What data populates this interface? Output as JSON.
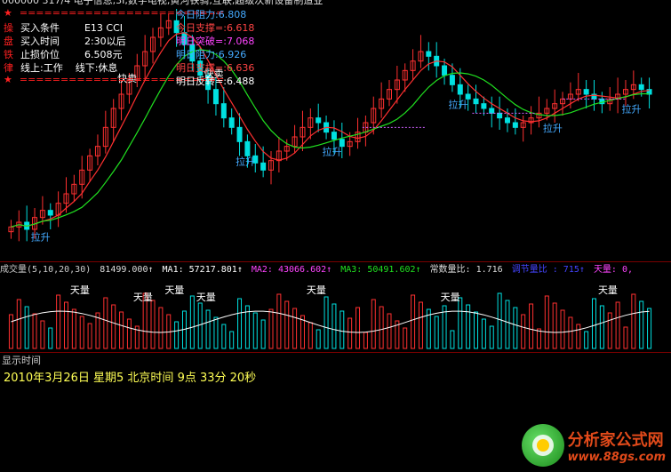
{
  "header": {
    "top_partial": "000000 317/4 电子信息,3I,数字电视,黄河铁骑,互联,超级次新设备制造业",
    "rows": [
      {
        "icon": "★",
        "label": "=========================",
        "color": "#ff2020"
      },
      {
        "icon": "操",
        "label": "买入条件        E13 CCI",
        "color": "#ffffff"
      },
      {
        "icon": "盘",
        "label": "买入时间        2:30以后",
        "color": "#ffffff"
      },
      {
        "icon": "铁",
        "label": "止损价位        6.508元",
        "color": "#ffffff"
      },
      {
        "icon": "律",
        "label": "线上:工作    线下:休息",
        "color": "#ffffff"
      },
      {
        "icon": "★",
        "label": "=========================",
        "color": "#ff2020"
      }
    ]
  },
  "levels": [
    {
      "label": "今日阻力:",
      "value": "6.808",
      "color": "#44aaff"
    },
    {
      "label": "今日支撑=:",
      "value": "6.618",
      "color": "#ff4444"
    },
    {
      "label": "明日突破=:",
      "value": "7.068",
      "color": "#ff44ff"
    },
    {
      "label": "明日阻力:",
      "value": "6.926",
      "color": "#44aaff"
    },
    {
      "label": "明日支撑=:",
      "value": "6.636",
      "color": "#ff4444"
    },
    {
      "label": "明日反转=:",
      "value": "6.488",
      "color": "#ffffff"
    }
  ],
  "indicator_strip": {
    "title": "成交量(5,10,20,30)",
    "vol": "81499.000↑",
    "ma1": "MA1: 57217.801↑",
    "ma2": "MA2: 43066.602↑",
    "ma3": "MA3: 50491.602↑",
    "ratio": "常数量比: 1.716",
    "extra": "调节量比 : 715↑",
    "sky": "天量: 0,"
  },
  "time_panel": {
    "label": "显示时间",
    "value": "2010年3月26日  星期5   北京时间  9点   33分   20秒"
  },
  "logo": {
    "cn": "分析家公式网",
    "url": "www.88gs.com"
  },
  "colors": {
    "up": "#ff3030",
    "down": "#00e0e0",
    "ma_fast": "#ff3030",
    "ma_slow": "#20e020",
    "dash": "#d060ff"
  },
  "chart_data": {
    "type": "line",
    "candles_close": [
      6.28,
      6.3,
      6.27,
      6.32,
      6.35,
      6.33,
      6.38,
      6.42,
      6.46,
      6.52,
      6.58,
      6.62,
      6.7,
      6.78,
      6.84,
      6.9,
      6.96,
      7.02,
      7.08,
      7.12,
      7.15,
      7.1,
      7.05,
      6.98,
      6.92,
      6.86,
      6.8,
      6.74,
      6.7,
      6.64,
      6.58,
      6.55,
      6.52,
      6.56,
      6.6,
      6.62,
      6.66,
      6.7,
      6.74,
      6.72,
      6.68,
      6.65,
      6.62,
      6.64,
      6.68,
      6.72,
      6.78,
      6.82,
      6.86,
      6.9,
      6.94,
      6.98,
      7.02,
      7.0,
      6.96,
      6.92,
      6.88,
      6.84,
      6.82,
      6.8,
      6.78,
      6.76,
      6.74,
      6.72,
      6.7,
      6.72,
      6.74,
      6.76,
      6.78,
      6.8,
      6.82,
      6.84,
      6.86,
      6.84,
      6.82,
      6.8,
      6.82,
      6.84,
      6.86,
      6.88,
      6.86,
      6.84
    ],
    "labels": [
      {
        "text": "拉升",
        "ref": 3
      },
      {
        "text": "快卖",
        "ref": 14
      },
      {
        "text": "快卖",
        "ref": 25
      },
      {
        "text": "拉升",
        "ref": 29
      },
      {
        "text": "拉升",
        "ref": 40
      },
      {
        "text": "拉升",
        "ref": 56
      },
      {
        "text": "拉升",
        "ref": 68
      },
      {
        "text": "拉升",
        "ref": 78
      }
    ],
    "volume_labels": [
      "天量",
      "天量",
      "天量",
      "天量",
      "天量",
      "天量",
      "天量"
    ]
  }
}
